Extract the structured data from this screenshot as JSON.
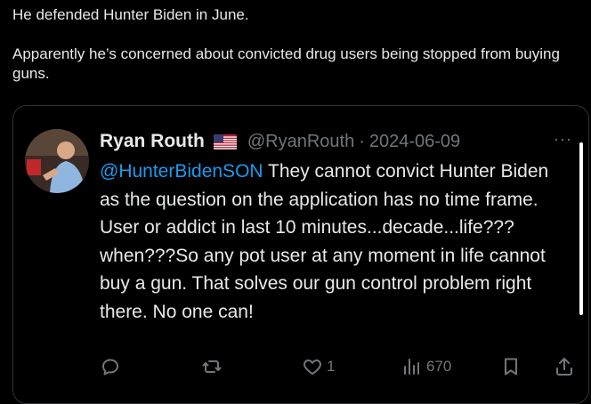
{
  "post": {
    "line1": "He defended Hunter Biden in June.",
    "line2": "Apparently he’s concerned about convicted drug users being stopped from buying guns."
  },
  "quote": {
    "author_name": "Ryan Routh",
    "flag": "🇺🇸",
    "handle": "@RyanRouth",
    "separator": "·",
    "date": "2024-06-09",
    "more": "···",
    "mention": "@HunterBidenSON",
    "text": " They cannot convict Hunter Biden as the question on the application has no time frame.  User or addict in last 10 minutes...decade...life???when???So any pot user at any moment in life cannot buy a gun. That solves our gun control problem right there. No one can!",
    "actions": {
      "reply_count": "",
      "repost_count": "",
      "like_count": "1",
      "views_count": "670"
    }
  },
  "icons": [
    "reply-icon",
    "repost-icon",
    "like-icon",
    "views-icon",
    "bookmark-icon",
    "share-icon",
    "more-icon"
  ],
  "colors": {
    "background": "#000000",
    "text": "#e7e9ea",
    "secondary": "#71767b",
    "link": "#1d9bf0",
    "border": "#2f3336"
  }
}
